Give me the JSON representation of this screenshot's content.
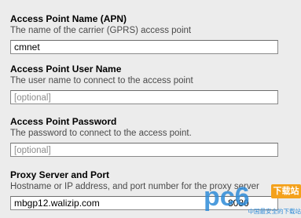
{
  "apn": {
    "label": "Access Point Name (APN)",
    "description": "The name of the carrier (GPRS) access point",
    "value": "cmnet",
    "placeholder": ""
  },
  "user": {
    "label": "Access Point User Name",
    "description": "The user name to connect to the access point",
    "value": "",
    "placeholder": "[optional]"
  },
  "password": {
    "label": "Access Point Password",
    "description": "The password to connect to the access point.",
    "value": "",
    "placeholder": "[optional]"
  },
  "proxy": {
    "label": "Proxy Server and Port",
    "description": "Hostname or IP address, and port number for the proxy server",
    "value": "mbgp12.walizip.com",
    "port": "8080",
    "placeholder": ""
  },
  "watermark": {
    "logo": "pc6",
    "badge": "下载站",
    "subtitle": "中国最安全的下载站"
  },
  "colors": {
    "background": "#ececec",
    "field_border": "#8a8a8a",
    "watermark_blue": "#2e8bd8",
    "watermark_orange": "#f4a11b"
  }
}
